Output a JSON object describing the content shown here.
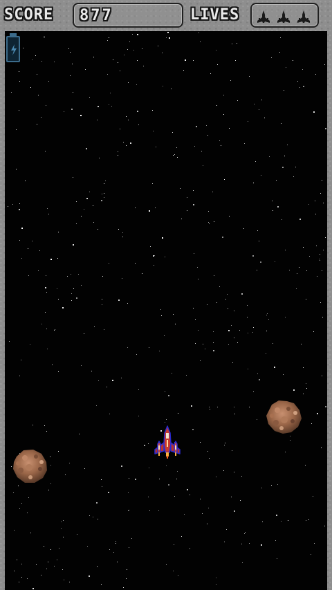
{
  "hud": {
    "score_label": "SCORE",
    "score_value": "877",
    "lives_label": "LIVES",
    "lives_count": 3
  },
  "power": {
    "icon": "lightning-bolt-icon"
  },
  "colors": {
    "frame": "#8e8e8e",
    "space": "#020202",
    "hud_text": "#e9e9e9",
    "battery": "#3c6c8c",
    "ship_body": "#c83a2e",
    "ship_outline": "#2a2ad0",
    "asteroid": "#9a6648"
  },
  "entities": [
    {
      "type": "player-ship"
    },
    {
      "type": "asteroid"
    },
    {
      "type": "asteroid"
    }
  ]
}
